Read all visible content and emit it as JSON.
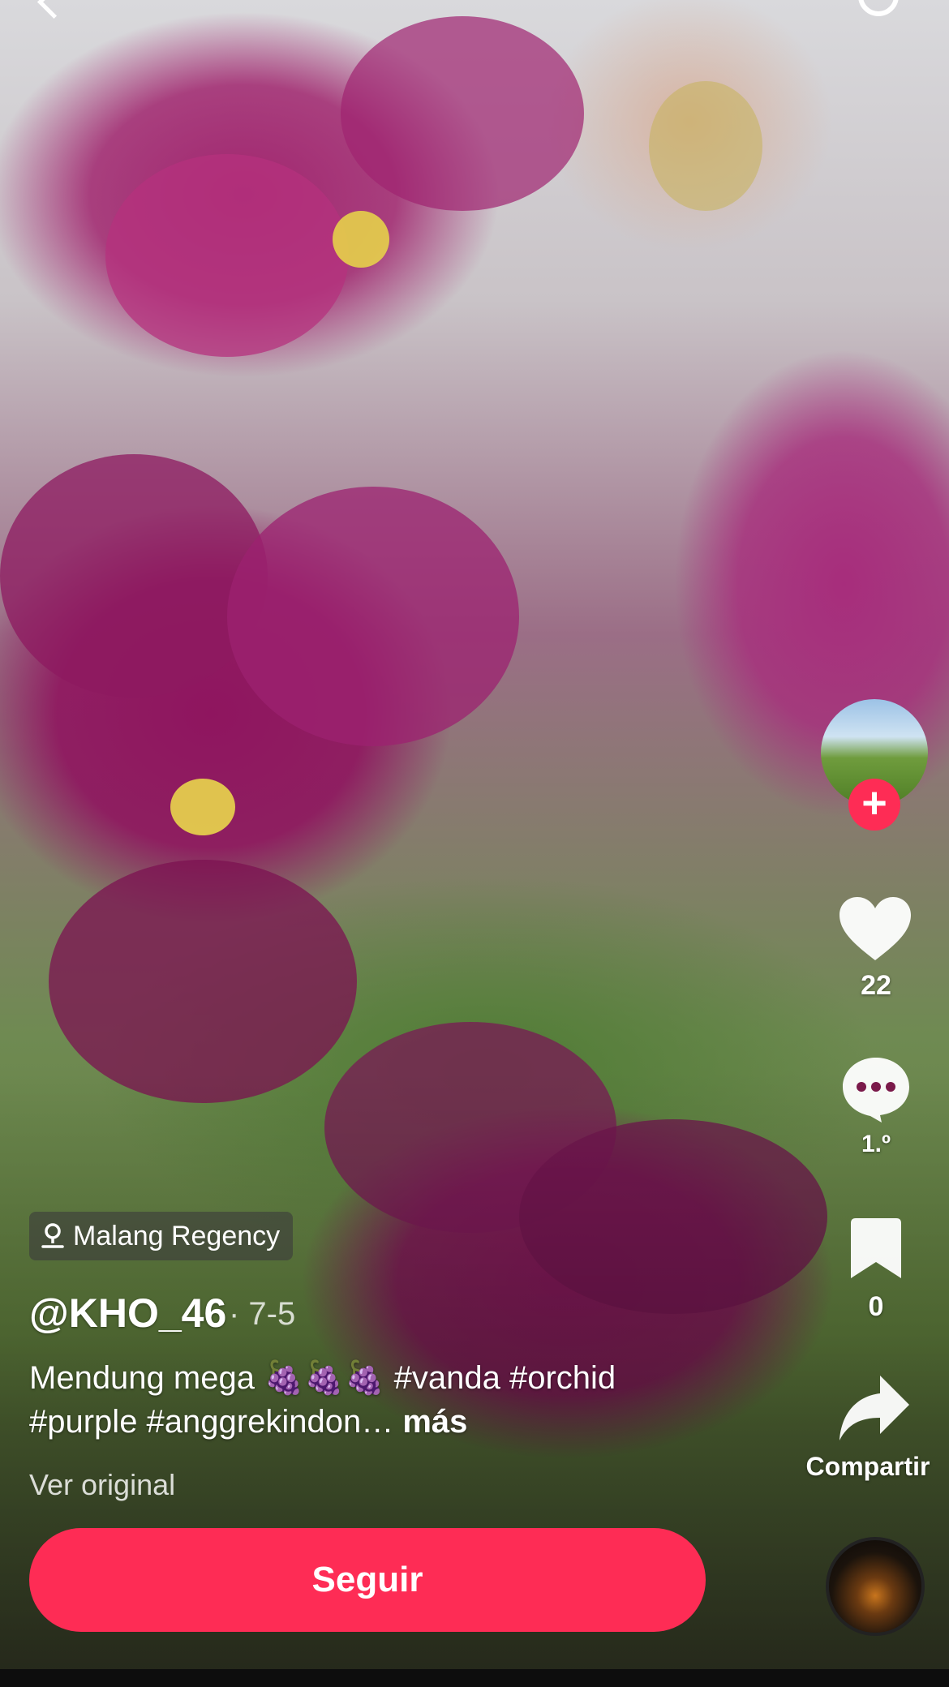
{
  "video": {
    "description_hidden": ""
  },
  "location": {
    "label": "Malang Regency"
  },
  "author": {
    "username": "@KHO_46",
    "date": "· 7-5"
  },
  "caption": {
    "text": "Mendung mega 🍇🍇🍇 #vanda #orchid #purple #anggrekindon…",
    "more": " más"
  },
  "translate": {
    "label": "Ver original"
  },
  "actions": {
    "likes": "22",
    "comments": "1.º",
    "saves": "0",
    "share_label": "Compartir"
  },
  "follow_button": {
    "label": "Seguir"
  },
  "colors": {
    "accent": "#fe2c55"
  }
}
